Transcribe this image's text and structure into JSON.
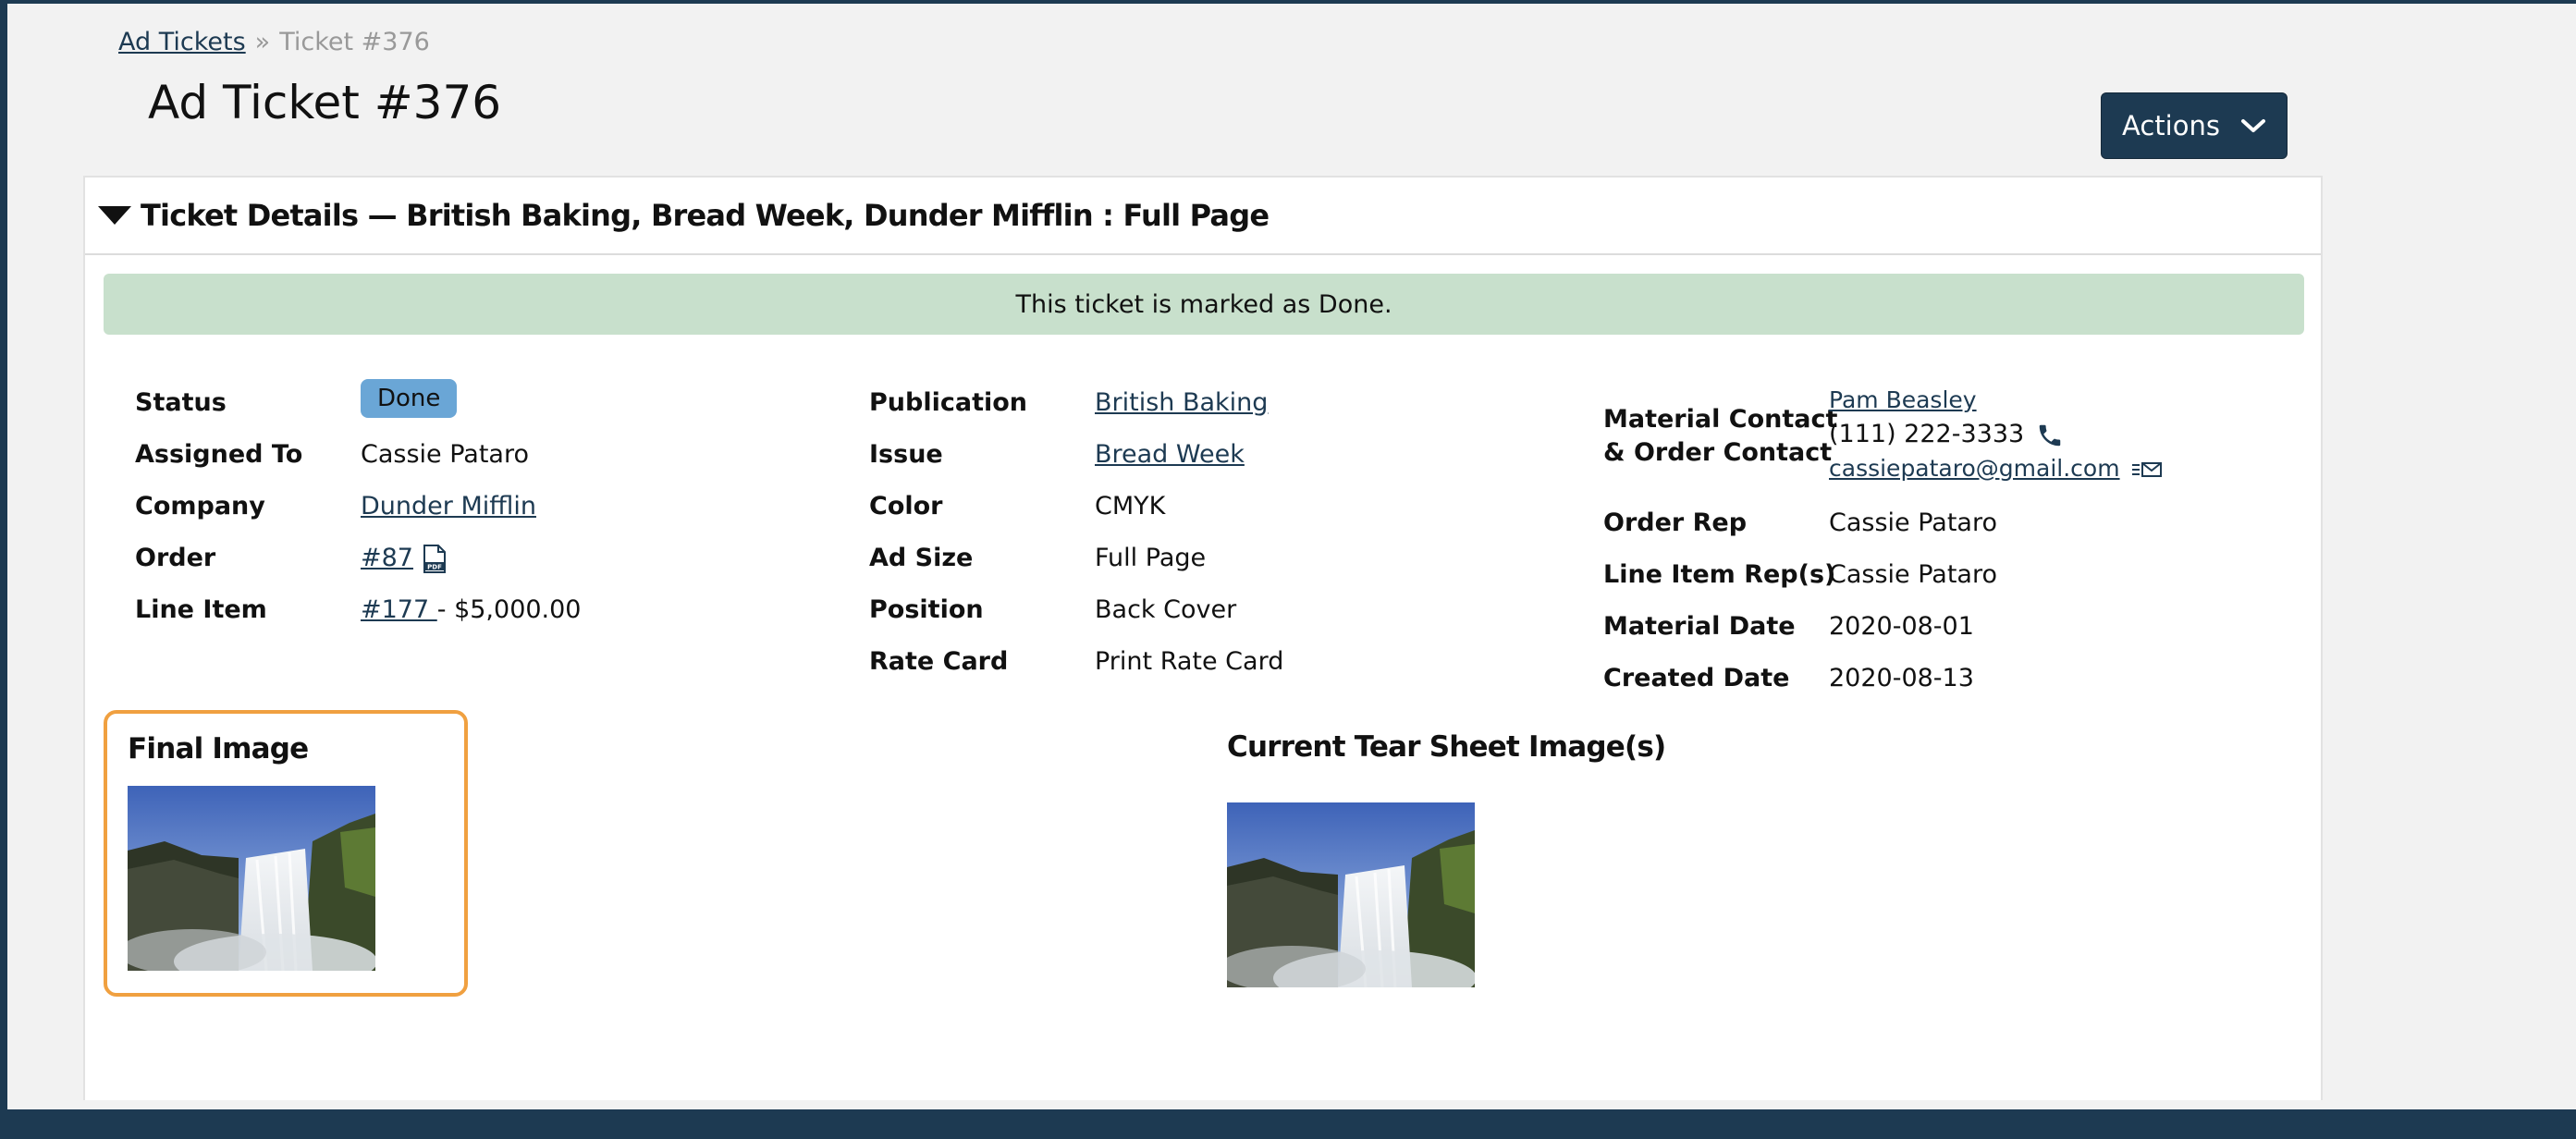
{
  "breadcrumb": {
    "parent": "Ad Tickets",
    "separator": "»",
    "current": "Ticket #376"
  },
  "page": {
    "title": "Ad Ticket #376"
  },
  "actions": {
    "label": "Actions"
  },
  "panel": {
    "title": "Ticket Details — British Baking, Bread Week, Dunder Mifflin : Full Page",
    "alert": "This ticket is marked as Done."
  },
  "details_left": {
    "status_label": "Status",
    "status_value": "Done",
    "assigned_label": "Assigned To",
    "assigned_value": "Cassie Pataro",
    "company_label": "Company",
    "company_value": "Dunder Mifflin",
    "order_label": "Order",
    "order_value": "#87",
    "line_item_label": "Line Item",
    "line_item_link": "#177 ",
    "line_item_amount": "- $5,000.00"
  },
  "details_middle": {
    "publication_label": "Publication",
    "publication_value": "British Baking",
    "issue_label": "Issue",
    "issue_value": "Bread Week",
    "color_label": "Color",
    "color_value": "CMYK",
    "ad_size_label": "Ad Size",
    "ad_size_value": "Full Page",
    "position_label": "Position",
    "position_value": "Back Cover",
    "rate_card_label": "Rate Card",
    "rate_card_value": "Print Rate Card"
  },
  "details_right": {
    "material_contact_label_1": "Material Contact",
    "material_contact_label_2": "& Order Contact",
    "contact_name": "Pam Beasley",
    "contact_phone": "(111) 222-3333",
    "contact_email": "cassiepataro@gmail.com",
    "order_rep_label": "Order Rep",
    "order_rep_value": "Cassie Pataro",
    "line_item_rep_label": "Line Item Rep(s)",
    "line_item_rep_value": "Cassie Pataro",
    "material_date_label": "Material Date",
    "material_date_value": "2020-08-01",
    "created_date_label": "Created Date",
    "created_date_value": "2020-08-13"
  },
  "images": {
    "final_title": "Final Image",
    "tear_sheet_title": "Current Tear Sheet Image(s)"
  },
  "icons": {
    "pdf": "pdf-file-icon",
    "phone": "phone-icon",
    "email": "email-icon",
    "dropdown": "chevron-down-icon",
    "collapse": "collapse-triangle-icon"
  },
  "colors": {
    "brand": "#1d3a52",
    "alert_bg": "#c8e0cc",
    "badge_bg": "#6aa6d6",
    "highlight": "#f0a040"
  }
}
